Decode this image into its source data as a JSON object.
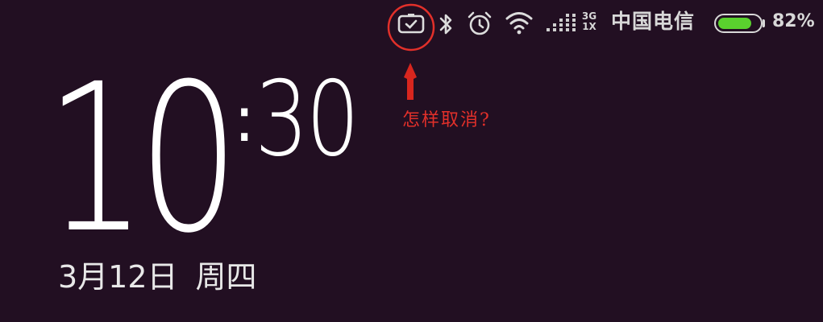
{
  "status_bar": {
    "icons": [
      "screen-shot-icon",
      "bluetooth-icon",
      "alarm-icon",
      "wifi-icon",
      "cellular-signal-icon"
    ],
    "network_3g": "3G",
    "network_1x": "1X",
    "carrier": "中国电信",
    "battery_level": 0.82,
    "battery_percent": "82%",
    "battery_color": "#5ad12e"
  },
  "annotation": {
    "text": "怎样取消?",
    "color": "#e2302a"
  },
  "clock": {
    "hour": "10",
    "separator": ":",
    "minute": "30"
  },
  "date": {
    "date_text": "3月12日",
    "weekday": "周四"
  },
  "colors": {
    "background": "#220f22"
  }
}
